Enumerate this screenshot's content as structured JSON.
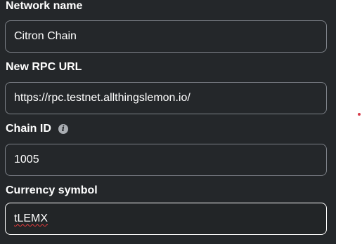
{
  "form": {
    "network_name": {
      "label": "Network name",
      "value": "Citron Chain"
    },
    "rpc_url": {
      "label": "New RPC URL",
      "value": "https://rpc.testnet.allthingslemon.io/"
    },
    "chain_id": {
      "label": "Chain ID",
      "info_icon": "info-icon",
      "value": "1005"
    },
    "currency_symbol": {
      "label": "Currency symbol",
      "value": "tLEMX"
    }
  },
  "colors": {
    "panel_background": "#24272a",
    "text": "#ffffff",
    "field_border": "#7c8087",
    "focused_border": "#ffffff",
    "spellcheck_underline": "#e43c3c",
    "indicator_dot": "#d73a49"
  }
}
